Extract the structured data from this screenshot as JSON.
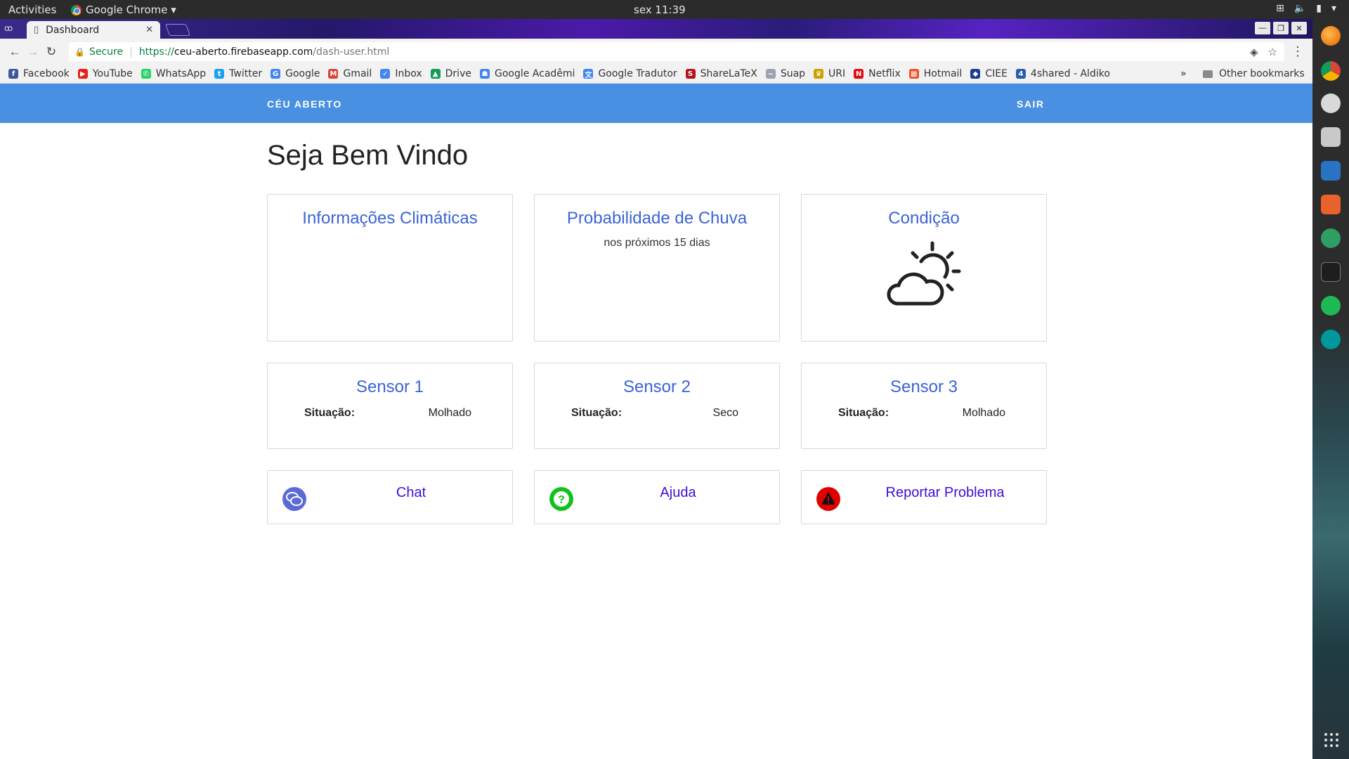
{
  "os": {
    "activities": "Activities",
    "app_menu": "Google Chrome ▾",
    "clock": "sex 11:39"
  },
  "browser": {
    "tab_title": "Dashboard",
    "omnibox": {
      "secure_label": "Secure",
      "scheme": "https://",
      "host": "ceu-aberto.firebaseapp.com",
      "path": "/dash-user.html"
    },
    "bookmarks": [
      {
        "label": "Facebook",
        "color": "#3b5998",
        "glyph": "f"
      },
      {
        "label": "YouTube",
        "color": "#e62117",
        "glyph": "▶"
      },
      {
        "label": "WhatsApp",
        "color": "#25d366",
        "glyph": "✆"
      },
      {
        "label": "Twitter",
        "color": "#1da1f2",
        "glyph": "t"
      },
      {
        "label": "Google",
        "color": "#4285f4",
        "glyph": "G"
      },
      {
        "label": "Gmail",
        "color": "#d44638",
        "glyph": "M"
      },
      {
        "label": "Inbox",
        "color": "#4285f4",
        "glyph": "✓"
      },
      {
        "label": "Drive",
        "color": "#0f9d58",
        "glyph": "▲"
      },
      {
        "label": "Google Acadêmi",
        "color": "#4285f4",
        "glyph": "☗"
      },
      {
        "label": "Google Tradutor",
        "color": "#4285f4",
        "glyph": "文"
      },
      {
        "label": "ShareLaTeX",
        "color": "#b5121b",
        "glyph": "S"
      },
      {
        "label": "Suap",
        "color": "#9aa5b1",
        "glyph": "~"
      },
      {
        "label": "URI",
        "color": "#c8a200",
        "glyph": "♛"
      },
      {
        "label": "Netflix",
        "color": "#e50914",
        "glyph": "N"
      },
      {
        "label": "Hotmail",
        "color": "#f25022",
        "glyph": "▦"
      },
      {
        "label": "CIEE",
        "color": "#1a3d8f",
        "glyph": "◆"
      },
      {
        "label": "4shared - Aldiko",
        "color": "#2a5db0",
        "glyph": "4"
      }
    ],
    "bookmarks_more": "»",
    "other_bookmarks": "Other bookmarks"
  },
  "app": {
    "brand": "CÉU ABERTO",
    "logout": "SAIR",
    "welcome": "Seja Bem Vindo",
    "cards": {
      "climate": {
        "title": "Informações Climáticas"
      },
      "rain": {
        "title": "Probabilidade de Chuva",
        "subtitle": "nos próximos 15 dias"
      },
      "condition": {
        "title": "Condição",
        "icon": "partly-cloudy-icon"
      }
    },
    "sensors": [
      {
        "title": "Sensor 1",
        "label": "Situação:",
        "value": "Molhado"
      },
      {
        "title": "Sensor 2",
        "label": "Situação:",
        "value": "Seco"
      },
      {
        "title": "Sensor 3",
        "label": "Situação:",
        "value": "Molhado"
      }
    ],
    "actions": [
      {
        "label": "Chat",
        "icon": "chat-icon",
        "color": "#5a6bd6"
      },
      {
        "label": "Ajuda",
        "icon": "help-icon",
        "color": "#11c21a"
      },
      {
        "label": "Reportar Problema",
        "icon": "warning-icon",
        "color": "#e00000"
      }
    ]
  }
}
